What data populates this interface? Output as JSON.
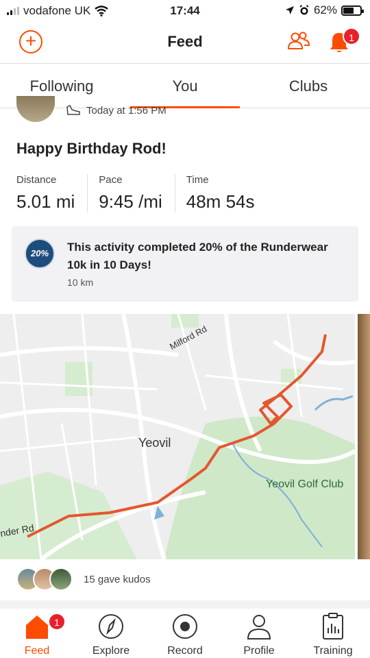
{
  "status_bar": {
    "carrier": "vodafone UK",
    "time": "17:44",
    "battery": "62%"
  },
  "header": {
    "title": "Feed",
    "notification_count": "1"
  },
  "tabs": [
    {
      "label": "Following",
      "active": false
    },
    {
      "label": "You",
      "active": true
    },
    {
      "label": "Clubs",
      "active": false
    }
  ],
  "activity": {
    "timestamp": "Today at 1:56 PM",
    "title": "Happy Birthday Rod!",
    "stats": [
      {
        "label": "Distance",
        "value": "5.01 mi"
      },
      {
        "label": "Pace",
        "value": "9:45 /mi"
      },
      {
        "label": "Time",
        "value": "48m 54s"
      }
    ],
    "challenge": {
      "badge_text": "20%",
      "text": "This activity completed 20% of the Runderwear 10k in 10 Days!",
      "sub": "10 km"
    },
    "map": {
      "labels": {
        "town": "Yeovil",
        "golf": "Yeovil Golf Club",
        "road1": "Milford Rd",
        "road2": "nder Rd"
      },
      "route_color": "#e4572e"
    },
    "kudos_text": "15 gave kudos"
  },
  "bottom_nav": {
    "items": [
      {
        "label": "Feed",
        "active": true
      },
      {
        "label": "Explore",
        "active": false
      },
      {
        "label": "Record",
        "active": false
      },
      {
        "label": "Profile",
        "active": false
      },
      {
        "label": "Training",
        "active": false
      }
    ],
    "feed_badge": "1"
  },
  "colors": {
    "accent": "#fc4c02",
    "badge_red": "#e8202b"
  }
}
